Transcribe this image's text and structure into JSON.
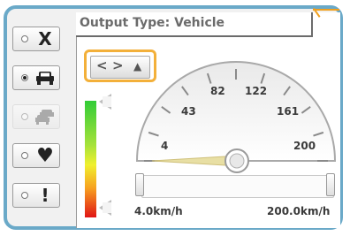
{
  "output_type": {
    "label": "Output Type: Vehicle"
  },
  "sidebar": {
    "buttons": [
      {
        "name": "clear",
        "glyph": "X",
        "selected": false,
        "disabled": false
      },
      {
        "name": "car",
        "glyph": "car-icon",
        "selected": true,
        "disabled": false
      },
      {
        "name": "traffic",
        "glyph": "two-cars-icon",
        "selected": false,
        "disabled": true
      },
      {
        "name": "heart",
        "glyph": "♥",
        "selected": false,
        "disabled": false
      },
      {
        "name": "alert",
        "glyph": "!",
        "selected": false,
        "disabled": false
      }
    ]
  },
  "nav": {
    "left": "<",
    "right": ">",
    "extra": "▲"
  },
  "gauge": {
    "ticks": [
      "4",
      "43",
      "82",
      "122",
      "161",
      "200"
    ],
    "needle_value": 4,
    "min": 4,
    "max": 200
  },
  "range": {
    "min_label": "4.0km/h",
    "max_label": "200.0km/h"
  },
  "colors": {
    "frame": "#6aa9c8",
    "highlight": "#f3b03a"
  }
}
